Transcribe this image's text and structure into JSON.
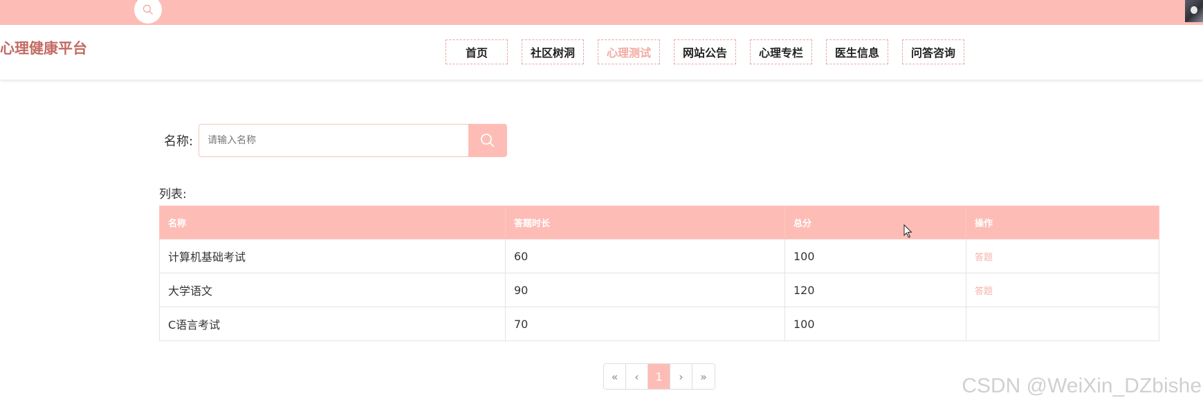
{
  "topbar": {
    "search_icon": "search-icon",
    "avatar_icon": "user-avatar"
  },
  "header": {
    "logo": "心理健康平台",
    "nav": [
      {
        "label": "首页",
        "active": false
      },
      {
        "label": "社区树洞",
        "active": false
      },
      {
        "label": "心理测试",
        "active": true
      },
      {
        "label": "网站公告",
        "active": false
      },
      {
        "label": "心理专栏",
        "active": false
      },
      {
        "label": "医生信息",
        "active": false
      },
      {
        "label": "问答咨询",
        "active": false
      }
    ]
  },
  "search": {
    "label": "名称:",
    "placeholder": "请输入名称",
    "value": "",
    "button_icon": "search-icon"
  },
  "list": {
    "label": "列表:",
    "columns": [
      "名称",
      "答题时长",
      "总分",
      "操作"
    ],
    "rows": [
      {
        "name": "计算机基础考试",
        "duration": "60",
        "score": "100",
        "action": "答题"
      },
      {
        "name": "大学语文",
        "duration": "90",
        "score": "120",
        "action": "答题"
      },
      {
        "name": "C语言考试",
        "duration": "70",
        "score": "100",
        "action": ""
      }
    ]
  },
  "pagination": {
    "first": "«",
    "prev": "‹",
    "current": "1",
    "next": "›",
    "last": "»"
  },
  "watermark": "CSDN @WeiXin_DZbishe",
  "colors": {
    "accent": "#fdbdb6",
    "logo": "#c36b63",
    "nav_active": "#f2aaa3",
    "action_link": "#f6b1aa"
  }
}
